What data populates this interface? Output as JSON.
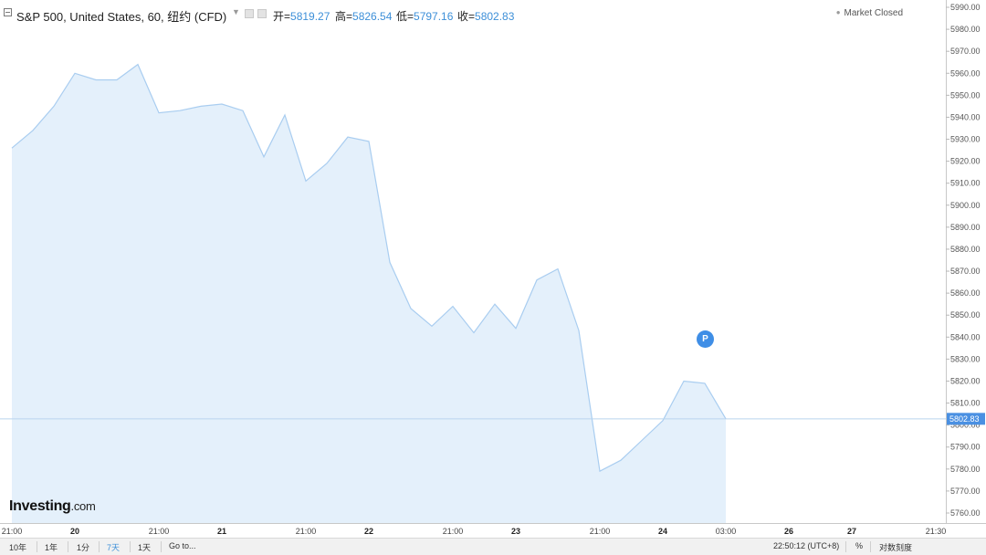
{
  "header": {
    "title": "S&P 500, United States, 60, 纽约 (CFD)",
    "open_label": "开=",
    "open_value": "5819.27",
    "high_label": "高=",
    "high_value": "5826.54",
    "low_label": "低=",
    "low_value": "5797.16",
    "close_label": "收=",
    "close_value": "5802.83",
    "market_status": "Market Closed",
    "icons": [
      "collapse-icon",
      "chevron-down-icon",
      "settings-icon",
      "compare-icon"
    ]
  },
  "watermark": {
    "brand": "Investing",
    "suffix": ".com"
  },
  "marker": {
    "label": "P"
  },
  "toolbar": {
    "ranges": [
      "10年",
      "1年",
      "1分",
      "7天",
      "1天",
      "Go to..."
    ],
    "active_range": "7天",
    "time": "22:50:12 (UTC+8)",
    "percent": "%",
    "scale": "对数刻度"
  },
  "colors": {
    "line": "#a9cdf0",
    "fill": "#e4f0fb",
    "accent": "#3d8fd8",
    "last_price_bg": "#4a90e2"
  },
  "chart_data": {
    "type": "area",
    "title": "S&P 500, United States, 60, 纽约 (CFD)",
    "ylim": [
      5755,
      5993
    ],
    "yticks": [
      5760,
      5770,
      5780,
      5790,
      5800,
      5810,
      5820,
      5830,
      5840,
      5850,
      5860,
      5870,
      5880,
      5890,
      5900,
      5910,
      5920,
      5930,
      5940,
      5950,
      5960,
      5970,
      5980,
      5990
    ],
    "y_tick_labels": [
      "5760.00",
      "5770.00",
      "5780.00",
      "5790.00",
      "5800.00",
      "5810.00",
      "5820.00",
      "5830.00",
      "5840.00",
      "5850.00",
      "5860.00",
      "5870.00",
      "5880.00",
      "5890.00",
      "5900.00",
      "5910.00",
      "5920.00",
      "5930.00",
      "5940.00",
      "5950.00",
      "5960.00",
      "5970.00",
      "5980.00",
      "5990.00"
    ],
    "x_tick_labels": [
      "21:00",
      "20",
      "21:00",
      "21",
      "21:00",
      "22",
      "21:00",
      "23",
      "21:00",
      "24",
      "03:00",
      "26",
      "27",
      "21:30"
    ],
    "x_tick_bold": [
      false,
      true,
      false,
      true,
      false,
      true,
      false,
      true,
      false,
      true,
      false,
      true,
      true,
      false
    ],
    "x_tick_slot": [
      0,
      6,
      14,
      20,
      28,
      34,
      42,
      48,
      56,
      62,
      68,
      74,
      80,
      88
    ],
    "x_slot_max": 90,
    "series": [
      {
        "x_slot": [
          0,
          2,
          4,
          6,
          8,
          10,
          12,
          14,
          16,
          18,
          20,
          22,
          24,
          26,
          28,
          30,
          32,
          34,
          36,
          38,
          40,
          42,
          44,
          46,
          48,
          50,
          52,
          54,
          56,
          58,
          60,
          62,
          64,
          66,
          68
        ],
        "values": [
          5926,
          5934,
          5945,
          5960,
          5957,
          5957,
          5964,
          5942,
          5943,
          5945,
          5946,
          5943,
          5922,
          5941,
          5911,
          5919,
          5931,
          5929,
          5874,
          5853,
          5845,
          5854,
          5842,
          5855,
          5844,
          5866,
          5871,
          5843,
          5779,
          5784,
          5793,
          5802,
          5820,
          5819,
          5802.83
        ]
      }
    ],
    "last_price": 5802.83,
    "last_price_label": "5802.83",
    "grid": false,
    "legend": "none"
  }
}
